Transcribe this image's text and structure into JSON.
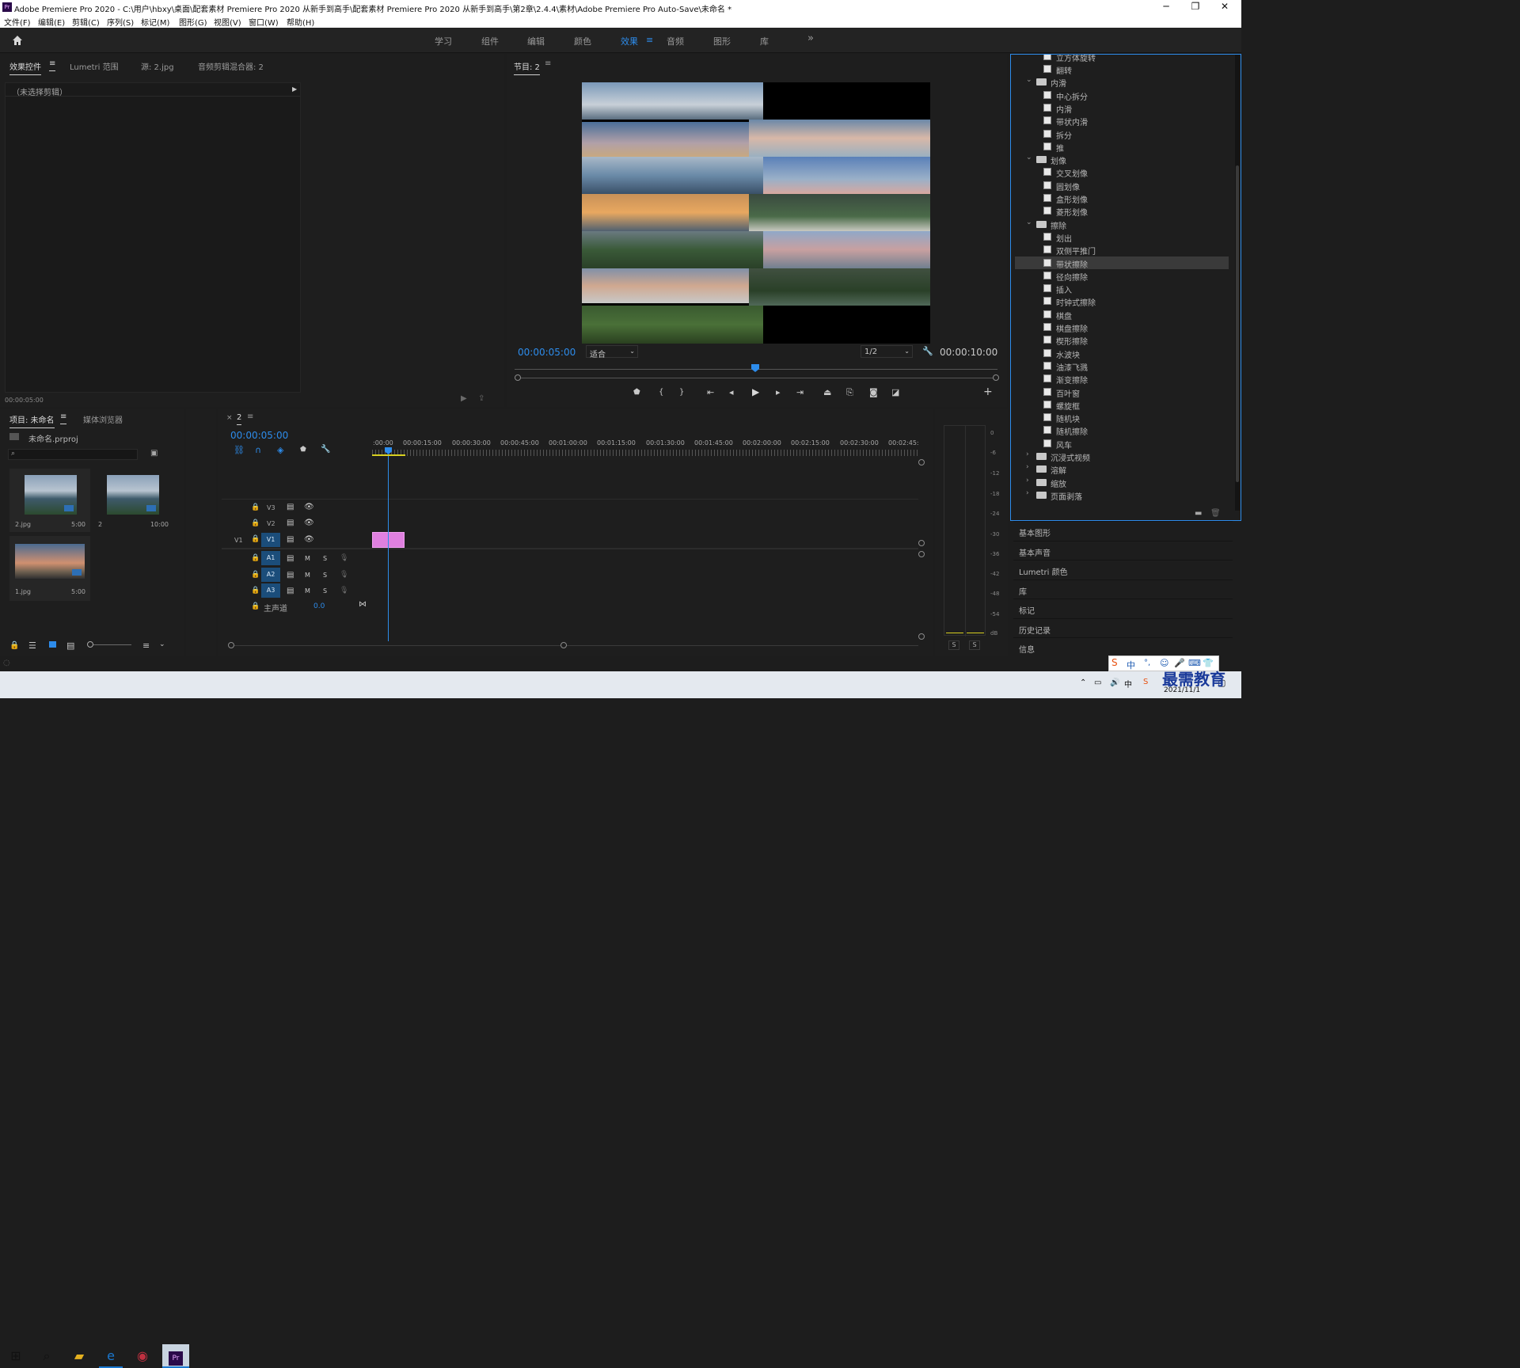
{
  "window": {
    "title": "Adobe Premiere Pro 2020 - C:\\用户\\hbxy\\桌面\\配套素材 Premiere Pro 2020 从新手到高手\\配套素材 Premiere Pro 2020 从新手到高手\\第2章\\2.4.4\\素材\\Adobe Premiere Pro Auto-Save\\未命名 *",
    "logo": "Pr",
    "minimize": "─",
    "maximize": "❐",
    "close": "✕"
  },
  "menu": [
    "文件(F)",
    "编辑(E)",
    "剪辑(C)",
    "序列(S)",
    "标记(M)",
    "图形(G)",
    "视图(V)",
    "窗口(W)",
    "帮助(H)"
  ],
  "workspaces": [
    "学习",
    "组件",
    "编辑",
    "颜色",
    "效果",
    "音频",
    "图形",
    "库"
  ],
  "workspace_active": "效果",
  "workspace_more": "»",
  "source_panel": {
    "tabs": [
      "效果控件",
      "Lumetri 范围",
      "源: 2.jpg",
      "音频剪辑混合器: 2"
    ],
    "no_clip": "（未选择剪辑）",
    "timecode": "00:00:05:00"
  },
  "program": {
    "title": "节目: 2",
    "timecode_left": "00:00:05:00",
    "fit": "适合",
    "resolution": "1/2",
    "timecode_right": "00:00:10:00"
  },
  "project": {
    "tabs": [
      "项目: 未命名",
      "媒体浏览器"
    ],
    "file": "未命名.prproj",
    "items": [
      {
        "name": "2.jpg",
        "duration": "5:00"
      },
      {
        "name": "2",
        "duration": "10:00"
      },
      {
        "name": "1.jpg",
        "duration": "5:00"
      }
    ]
  },
  "timeline": {
    "tab": "2",
    "timecode": "00:00:05:00",
    "ruler": [
      ":00:00",
      "00:00:15:00",
      "00:00:30:00",
      "00:00:45:00",
      "00:01:00:00",
      "00:01:15:00",
      "00:01:30:00",
      "00:01:45:00",
      "00:02:00:00",
      "00:02:15:00",
      "00:02:30:00",
      "00:02:45:"
    ],
    "video_tracks": [
      "V3",
      "V2",
      "V1"
    ],
    "audio_tracks": [
      "A1",
      "A2",
      "A3"
    ],
    "source_v": "V1",
    "track_m": "M",
    "track_s": "S",
    "master_label": "主声道",
    "master_value": "0.0"
  },
  "meter": {
    "scale": [
      "0",
      "-6",
      "-12",
      "-18",
      "-24",
      "-30",
      "-36",
      "-42",
      "-48",
      "-54",
      "dB"
    ],
    "s_left": "S",
    "s_right": "S"
  },
  "effects_tree": {
    "top_cut": "立方体旋转",
    "items": [
      {
        "type": "item",
        "label": "翻转"
      },
      {
        "type": "folder",
        "label": "内滑",
        "open": true
      },
      {
        "type": "item",
        "label": "中心拆分"
      },
      {
        "type": "item",
        "label": "内滑"
      },
      {
        "type": "item",
        "label": "带状内滑"
      },
      {
        "type": "item",
        "label": "拆分"
      },
      {
        "type": "item",
        "label": "推"
      },
      {
        "type": "folder",
        "label": "划像",
        "open": true
      },
      {
        "type": "item",
        "label": "交叉划像"
      },
      {
        "type": "item",
        "label": "圆划像"
      },
      {
        "type": "item",
        "label": "盒形划像"
      },
      {
        "type": "item",
        "label": "菱形划像"
      },
      {
        "type": "folder",
        "label": "擦除",
        "open": true
      },
      {
        "type": "item",
        "label": "划出"
      },
      {
        "type": "item",
        "label": "双侧平推门"
      },
      {
        "type": "item",
        "label": "带状擦除",
        "selected": true
      },
      {
        "type": "item",
        "label": "径向擦除"
      },
      {
        "type": "item",
        "label": "插入"
      },
      {
        "type": "item",
        "label": "时钟式擦除"
      },
      {
        "type": "item",
        "label": "棋盘"
      },
      {
        "type": "item",
        "label": "棋盘擦除"
      },
      {
        "type": "item",
        "label": "楔形擦除"
      },
      {
        "type": "item",
        "label": "水波块"
      },
      {
        "type": "item",
        "label": "油漆飞溅"
      },
      {
        "type": "item",
        "label": "渐变擦除"
      },
      {
        "type": "item",
        "label": "百叶窗"
      },
      {
        "type": "item",
        "label": "螺旋框"
      },
      {
        "type": "item",
        "label": "随机块"
      },
      {
        "type": "item",
        "label": "随机擦除"
      },
      {
        "type": "item",
        "label": "风车"
      },
      {
        "type": "folder",
        "label": "沉浸式视频",
        "open": false
      },
      {
        "type": "folder",
        "label": "溶解",
        "open": false
      },
      {
        "type": "folder",
        "label": "缩放",
        "open": false
      },
      {
        "type": "folder",
        "label": "页面剥落",
        "open": false
      }
    ]
  },
  "side_panels": [
    "基本图形",
    "基本声音",
    "Lumetri 颜色",
    "库",
    "标记",
    "历史记录",
    "信息"
  ],
  "taskbar": {
    "date": "2021/11/1",
    "ime": "中",
    "watermark": "最需教育"
  },
  "colors": {
    "accent": "#2d8ceb",
    "clip": "#e080e0",
    "bg": "#1d1d1d"
  }
}
